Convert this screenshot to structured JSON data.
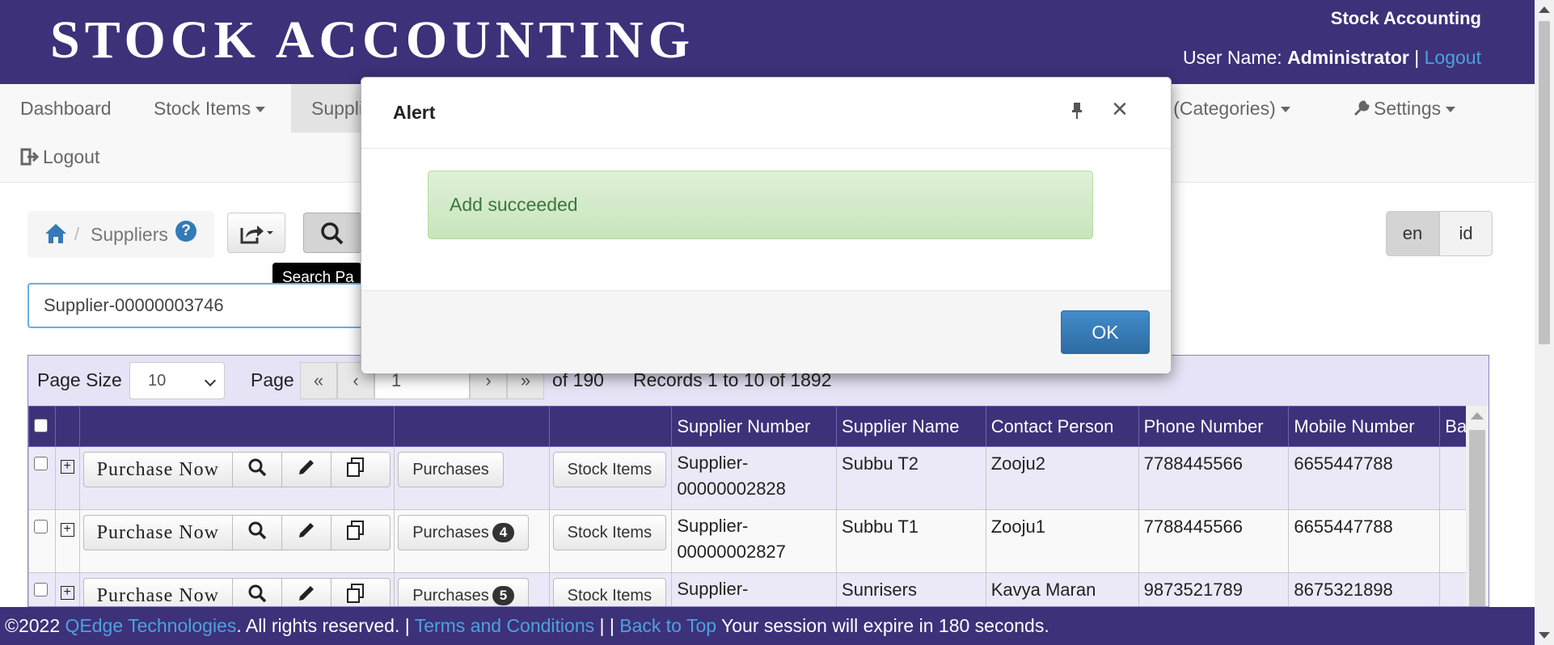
{
  "header": {
    "brand": "STOCK ACCOUNTING",
    "app_title": "Stock Accounting",
    "user_label": "User Name:",
    "user_name": "Administrator",
    "separator": "|",
    "logout": "Logout"
  },
  "nav": {
    "items": [
      {
        "label": "Dashboard"
      },
      {
        "label": "Stock Items"
      },
      {
        "label": "Suppli"
      },
      {
        "label": "p (Categories)"
      },
      {
        "label": "Settings"
      },
      {
        "label": "Logout"
      }
    ]
  },
  "breadcrumb": {
    "separator": "/",
    "label": "Suppliers",
    "help": "?"
  },
  "tooltip": "Search Pa",
  "language": {
    "en": "en",
    "id": "id"
  },
  "search": {
    "value": "Supplier-00000003746"
  },
  "pager": {
    "page_size_label": "Page Size",
    "page_size": "10",
    "page_label": "Page",
    "page": "1",
    "of_pages": "of 190",
    "records": "Records 1 to 10 of 1892"
  },
  "table": {
    "columns": [
      "Supplier Number",
      "Supplier Name",
      "Contact Person",
      "Phone Number",
      "Mobile Number",
      "Bala"
    ],
    "purchase_now": "Purchase Now",
    "purchases_label": "Purchases",
    "stock_items_label": "Stock Items",
    "rows": [
      {
        "number": "Supplier-\n00000002828",
        "name": "Subbu T2",
        "contact": "Zooju2",
        "phone": "7788445566",
        "mobile": "6655447788",
        "badge": ""
      },
      {
        "number": "Supplier-\n00000002827",
        "name": "Subbu T1",
        "contact": "Zooju1",
        "phone": "7788445566",
        "mobile": "6655447788",
        "badge": "4"
      },
      {
        "number": "Supplier-",
        "name": "Sunrisers",
        "contact": "Kavya Maran",
        "phone": "9873521789",
        "mobile": "8675321898",
        "badge": "5"
      }
    ]
  },
  "footer": {
    "copyright": "©2022",
    "company": "QEdge Technologies",
    "rights": ". All rights reserved. |",
    "terms": "Terms and Conditions",
    "sep": "| |",
    "back_to_top": "Back to Top",
    "session": "Your session will expire in 180 seconds."
  },
  "modal": {
    "title": "Alert",
    "close": "×",
    "message": "Add succeeded",
    "ok": "OK"
  },
  "colors": {
    "brand": "#3d3179",
    "link": "#4aa3df",
    "success_bg": "#dff0d8",
    "primary": "#337ab7"
  }
}
